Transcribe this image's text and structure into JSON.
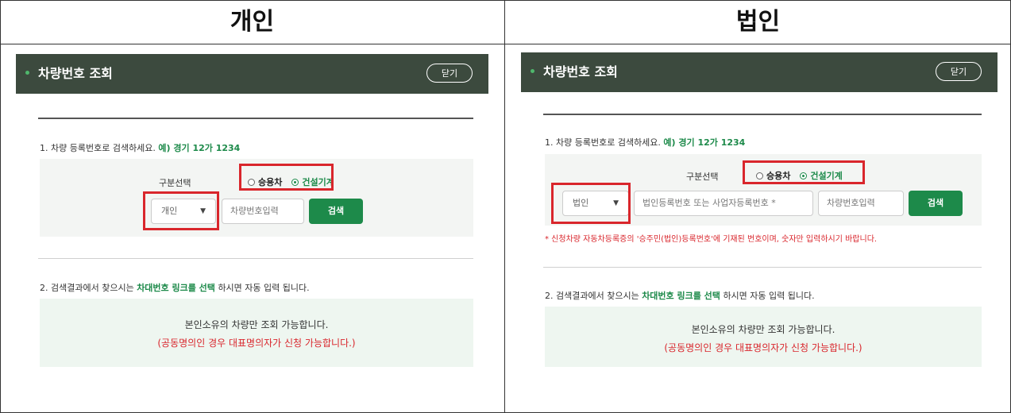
{
  "columns": {
    "left_title": "개인",
    "right_title": "법인"
  },
  "panel_left": {
    "header_title": "차량번호 조회",
    "close_label": "닫기",
    "step1_text": "1. 차량 등록번호로 검색하세요.",
    "step1_example": "예) 경기 12가 1234",
    "segment_label": "구분선택",
    "radio_passenger": "승용차",
    "radio_construction": "건설기계",
    "select_value": "개인",
    "plate_placeholder": "차량번호입력",
    "search_label": "검색",
    "step2_prefix": "2. 검색결과에서 찾으시는",
    "step2_link": "차대번호 링크를 선택",
    "step2_suffix": "하시면 자동 입력 됩니다.",
    "info_line1": "본인소유의 차량만 조회 가능합니다.",
    "info_line2": "(공동명의인 경우 대표명의자가 신청 가능합니다.)"
  },
  "panel_right": {
    "header_title": "차량번호 조회",
    "close_label": "닫기",
    "step1_text": "1. 차량 등록번호로 검색하세요.",
    "step1_example": "예) 경기 12가 1234",
    "segment_label": "구분선택",
    "radio_passenger": "승용차",
    "radio_construction": "건설기계",
    "select_value": "법인",
    "corp_placeholder": "법인등록번호 또는 사업자등록번호 *",
    "plate_placeholder": "차량번호입력",
    "search_label": "검색",
    "warning": "* 신청차량 자동차등록증의 '승주민(법인)등록번호'에 기재된 번호이며, 숫자만 입력하시기 바랍니다.",
    "step2_prefix": "2. 검색결과에서 찾으시는",
    "step2_link": "차대번호 링크를 선택",
    "step2_suffix": "하시면 자동 입력 됩니다.",
    "info_line1": "본인소유의 차량만 조회 가능합니다.",
    "info_line2": "(공동명의인 경우 대표명의자가 신청 가능합니다.)"
  },
  "colors": {
    "header_bg": "#3c4a3e",
    "accent_green": "#1d8a4a",
    "highlight_red": "#d9262c",
    "info_bg": "#eef6f0"
  }
}
